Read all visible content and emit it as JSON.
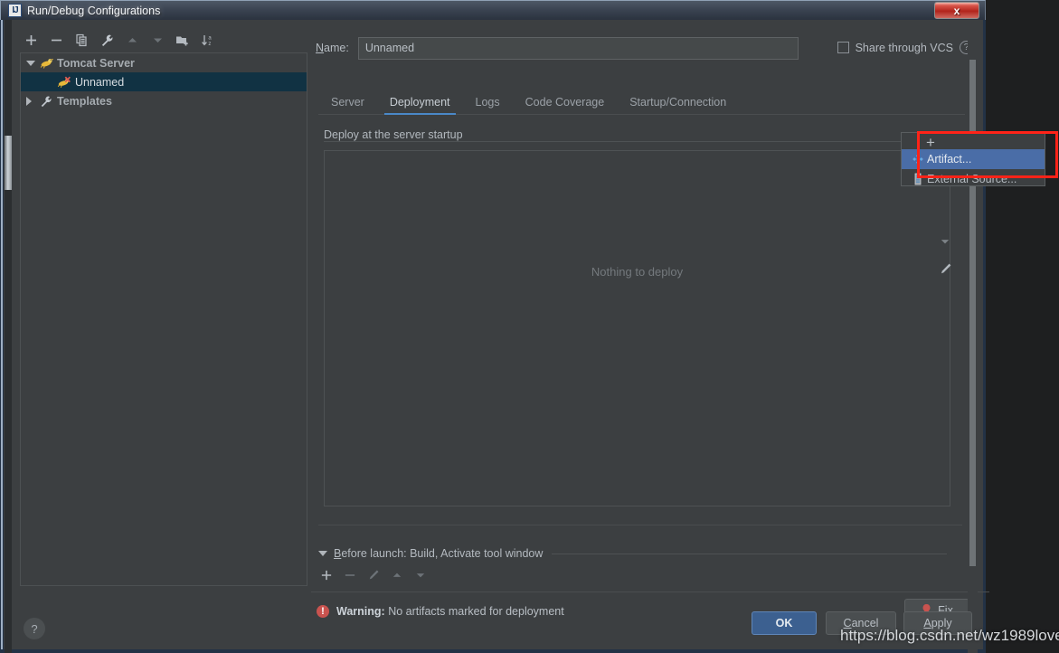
{
  "window": {
    "title": "Run/Debug Configurations",
    "app_icon": "intellij-idea-icon",
    "close_label": "x"
  },
  "left_panel": {
    "toolbar": [
      {
        "name": "add-configuration-button",
        "glyph": "+",
        "enabled": true
      },
      {
        "name": "remove-configuration-button",
        "glyph": "−",
        "enabled": true
      },
      {
        "name": "copy-configuration-button",
        "glyph": "copy-icon",
        "enabled": true
      },
      {
        "name": "edit-templates-button",
        "glyph": "wrench-icon",
        "enabled": true
      },
      {
        "name": "move-up-button",
        "glyph": "triangle-up-icon",
        "enabled": false
      },
      {
        "name": "move-down-button",
        "glyph": "triangle-down-icon",
        "enabled": false
      },
      {
        "name": "new-folder-button",
        "glyph": "folder-add-icon",
        "enabled": true
      },
      {
        "name": "sort-alphabetically-button",
        "glyph": "sort-az-icon",
        "enabled": true
      }
    ],
    "tree": [
      {
        "label": "Tomcat Server",
        "icon": "tomcat-icon",
        "expanded": true,
        "level": 0,
        "selected": false
      },
      {
        "label": "Unnamed",
        "icon": "tomcat-error-icon",
        "level": 1,
        "selected": true
      },
      {
        "label": "Templates",
        "icon": "wrench-icon",
        "expanded": false,
        "level": 0,
        "selected": false
      }
    ]
  },
  "right_panel": {
    "name_label": "Name:",
    "name_value": "Unnamed",
    "share_vcs_label": "Share through VCS",
    "share_vcs_checked": false,
    "help_icon": "question-circle-icon",
    "tabs": [
      {
        "label": "Server",
        "active": false
      },
      {
        "label": "Deployment",
        "active": true
      },
      {
        "label": "Logs",
        "active": false
      },
      {
        "label": "Code Coverage",
        "active": false
      },
      {
        "label": "Startup/Connection",
        "active": false
      }
    ],
    "deploy_group_label": "Deploy at the server startup",
    "deploy_empty_text": "Nothing to deploy",
    "deploy_side_toolbar": [
      {
        "name": "deploy-move-down-button",
        "glyph": "triangle-down-icon"
      },
      {
        "name": "deploy-edit-button",
        "glyph": "pencil-icon"
      }
    ],
    "before_launch_label_prefix": "B",
    "before_launch_label_rest": "efore launch: Build, Activate tool window",
    "before_launch_toolbar": [
      {
        "name": "before-launch-add-button",
        "glyph": "+",
        "enabled": true
      },
      {
        "name": "before-launch-remove-button",
        "glyph": "−",
        "enabled": false
      },
      {
        "name": "before-launch-edit-button",
        "glyph": "pencil-icon",
        "enabled": false
      },
      {
        "name": "before-launch-move-up-button",
        "glyph": "triangle-up-icon",
        "enabled": false
      },
      {
        "name": "before-launch-move-down-button",
        "glyph": "triangle-down-icon",
        "enabled": false
      }
    ],
    "warning_prefix": "Warning:",
    "warning_text": "No artifacts marked for deployment",
    "fix_label": "Fix"
  },
  "popup_menu": {
    "plus_glyph": "+",
    "items": [
      {
        "label": "Artifact...",
        "icon": "artifact-icon",
        "selected": true
      },
      {
        "label": "External Source...",
        "icon": "external-source-icon",
        "selected": false
      }
    ],
    "highlight_color": "#ff2318"
  },
  "buttons": {
    "ok": "OK",
    "cancel_first": "C",
    "cancel_rest": "ancel",
    "apply_first": "A",
    "apply_rest": "pply",
    "help": "?"
  },
  "watermark": "https://blog.csdn.net/wz1989love",
  "colors": {
    "dialog_bg": "#3c3f41",
    "accent_blue": "#4a88c7",
    "selection_blue": "#4a6da7",
    "tree_selection": "#113243",
    "warning_red": "#c9534f",
    "ok_button": "#3c6090"
  }
}
